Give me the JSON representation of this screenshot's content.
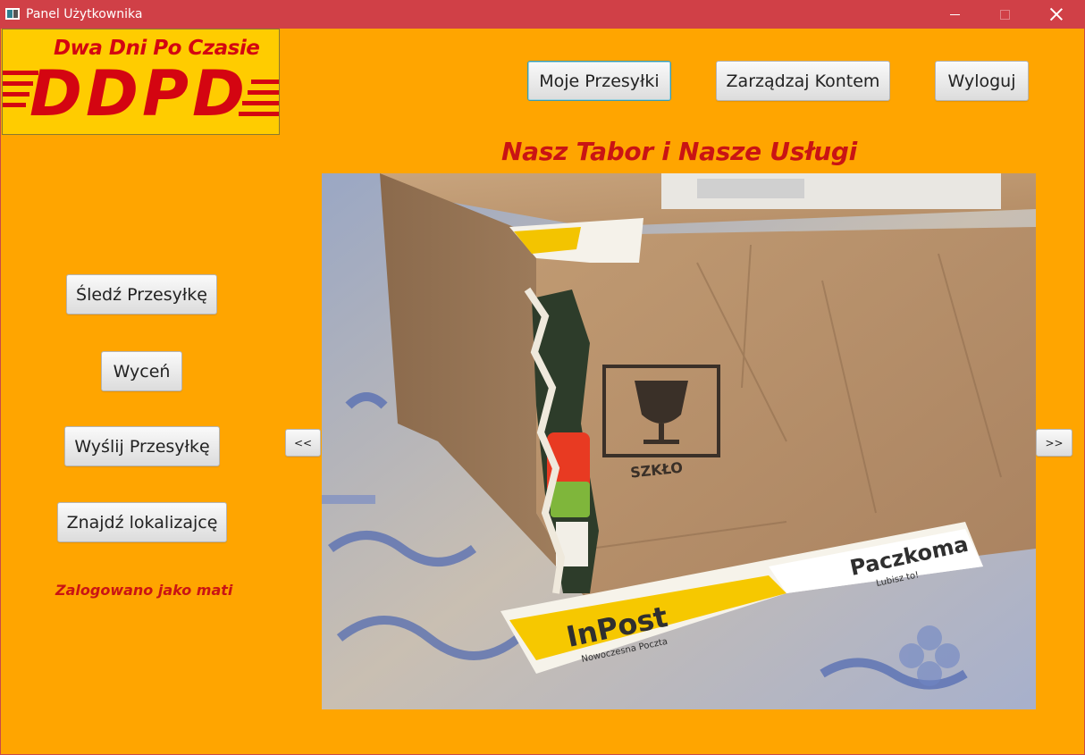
{
  "window": {
    "title": "Panel Użytkownika"
  },
  "logo": {
    "tagline": "Dwa Dni Po Czasie",
    "wordmark": "DDPD",
    "colors": {
      "background": "#ffcc00",
      "text": "#d40511"
    }
  },
  "top_nav": {
    "my_shipments": "Moje Przesyłki",
    "manage_account": "Zarządzaj Kontem",
    "logout": "Wyloguj"
  },
  "side_nav": {
    "track": "Śledź Przesyłkę",
    "quote": "Wyceń",
    "send": "Wyślij Przesyłkę",
    "find_location": "Znajdź lokalizajcę"
  },
  "status": {
    "logged_in": "Zalogowano jako mati"
  },
  "gallery": {
    "heading": "Nasz Tabor i Nasze Usługi",
    "prev": "<<",
    "next": ">>",
    "box_label": "SZKŁO",
    "sticker_brand": "InPost",
    "sticker_sub": "Nowoczesna Poczta",
    "sticker_brand_2": "Paczkoma",
    "sticker_sub_2": "Lubisz to!"
  },
  "colors": {
    "window_background": "#ffa500",
    "titlebar": "#d04047",
    "accent_text": "#c91414"
  }
}
